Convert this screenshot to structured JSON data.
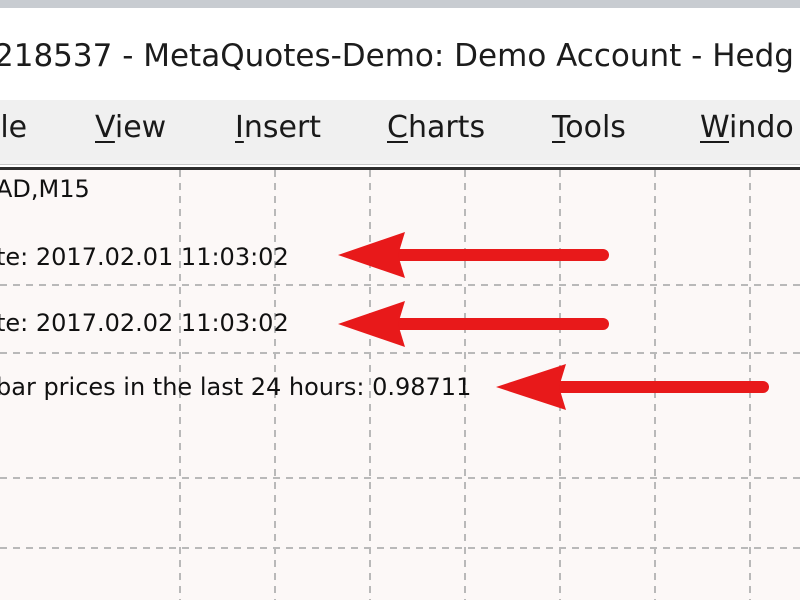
{
  "window": {
    "title": "218537 - MetaQuotes-Demo: Demo Account - Hedg"
  },
  "menu": {
    "items": [
      {
        "prefix": "",
        "underlined": "",
        "rest": "ile"
      },
      {
        "prefix": "",
        "underlined": "V",
        "rest": "iew"
      },
      {
        "prefix": "",
        "underlined": "I",
        "rest": "nsert"
      },
      {
        "prefix": "",
        "underlined": "C",
        "rest": "harts"
      },
      {
        "prefix": "",
        "underlined": "T",
        "rest": "ools"
      },
      {
        "prefix": "",
        "underlined": "W",
        "rest": "indo"
      }
    ]
  },
  "chart": {
    "symbol_line": "AD,M15",
    "comment_lines": [
      "te: 2017.02.01 11:03:02",
      "te: 2017.02.02 11:03:02",
      "bar prices in the last 24 hours: 0.98711"
    ]
  },
  "colors": {
    "arrow": "#e8191a",
    "grid": "#b9b9b9",
    "chart_bg": "#fcf8f7"
  },
  "icons": {
    "annotation": "red-arrow-icon"
  }
}
